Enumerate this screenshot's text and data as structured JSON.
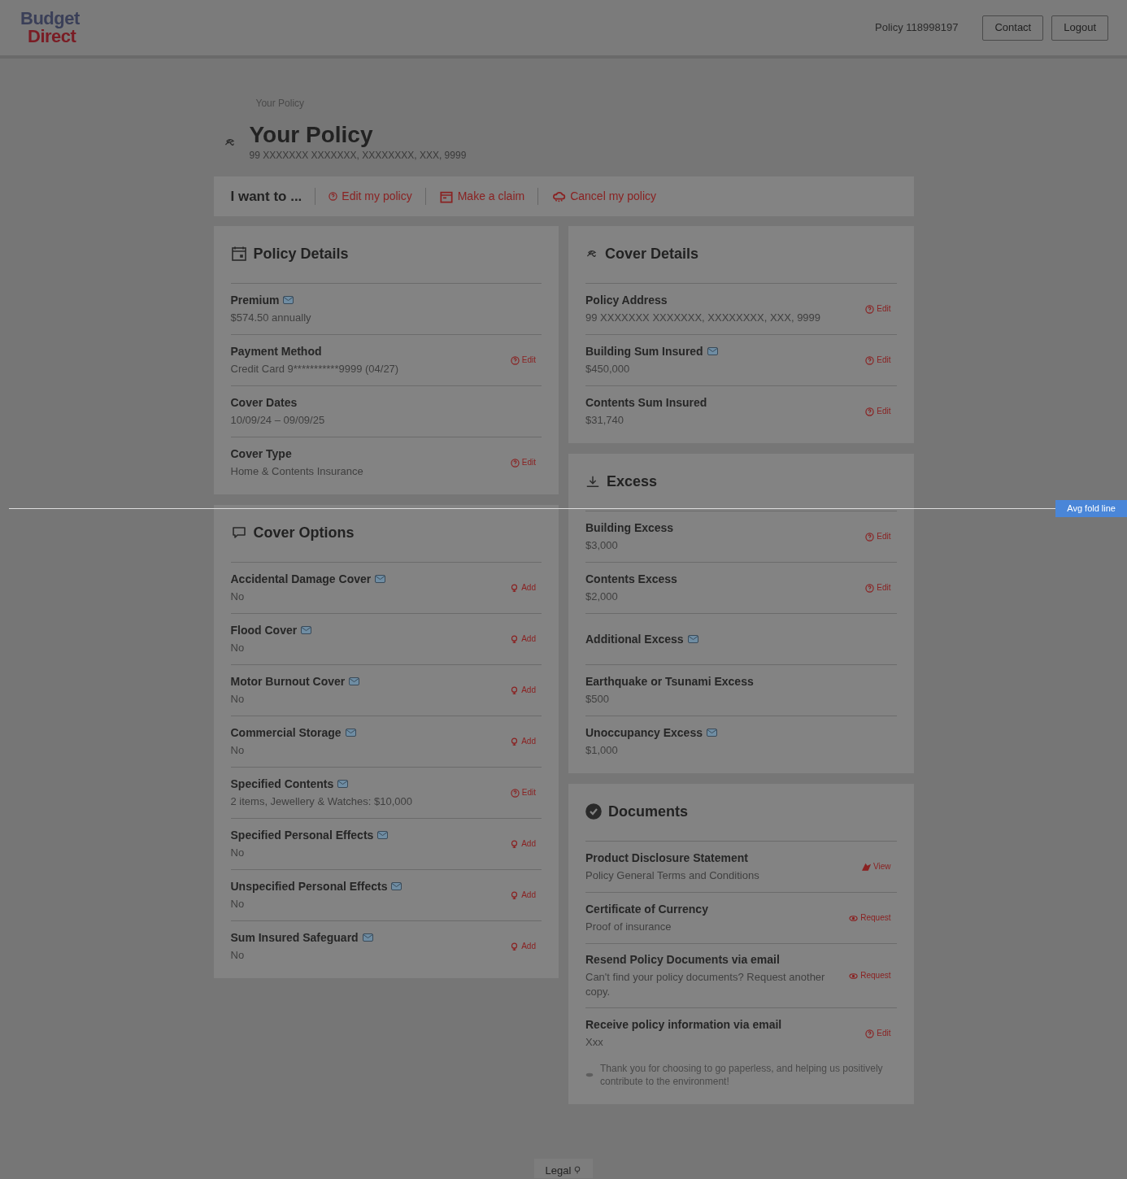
{
  "header": {
    "logo": [
      "Budget",
      "Direct"
    ],
    "policy_number": "Policy 118998197",
    "buttons": [
      "Contact",
      "Logout"
    ]
  },
  "breadcrumb": "Your Policy",
  "title": "Your Policy",
  "address": "99 XXXXXXX XXXXXXX, XXXXXXXX, XXX, 9999",
  "actions_bar": {
    "label": "I want to ...",
    "links": [
      {
        "kind": "edit",
        "label": "Edit my policy"
      },
      {
        "kind": "claim",
        "label": "Make a claim"
      },
      {
        "kind": "cancel",
        "label": "Cancel my policy"
      }
    ]
  },
  "columns": [
    [
      {
        "kind": "calendar",
        "title": "Policy Details",
        "rows": [
          {
            "label": "Premium",
            "value": "$574.50 annually",
            "info": true
          },
          {
            "label": "Payment Method",
            "value": "Credit Card 9***********9999 (04/27)",
            "info": false,
            "action": {
              "kind": "edit",
              "label": "Edit"
            }
          },
          {
            "label": "Cover Dates",
            "value": "10/09/24 – 09/09/25",
            "info": false
          },
          {
            "label": "Cover Type",
            "value": "Home & Contents Insurance",
            "info": false,
            "action": {
              "kind": "edit",
              "label": "Edit"
            }
          }
        ]
      },
      {
        "kind": "chat",
        "title": "Cover Options",
        "rows": [
          {
            "label": "Accidental Damage Cover",
            "value": "No",
            "info": true,
            "action": {
              "kind": "add",
              "label": "Add"
            }
          },
          {
            "label": "Flood Cover",
            "value": "No",
            "info": true,
            "action": {
              "kind": "add",
              "label": "Add"
            }
          },
          {
            "label": "Motor Burnout Cover",
            "value": "No",
            "info": true,
            "action": {
              "kind": "add",
              "label": "Add"
            }
          },
          {
            "label": "Commercial Storage",
            "value": "No",
            "info": true,
            "action": {
              "kind": "add",
              "label": "Add"
            }
          },
          {
            "label": "Specified Contents",
            "value": "2 items, Jewellery & Watches: $10,000",
            "info": true,
            "action": {
              "kind": "edit",
              "label": "Edit"
            }
          },
          {
            "label": "Specified Personal Effects",
            "value": "No",
            "info": true,
            "action": {
              "kind": "add",
              "label": "Add"
            }
          },
          {
            "label": "Unspecified Personal Effects",
            "value": "No",
            "info": true,
            "action": {
              "kind": "add",
              "label": "Add"
            }
          },
          {
            "label": "Sum Insured Safeguard",
            "value": "No",
            "info": true,
            "action": {
              "kind": "add",
              "label": "Add"
            }
          }
        ]
      }
    ],
    [
      {
        "kind": "umbrella",
        "title": "Cover Details",
        "rows": [
          {
            "label": "Policy Address",
            "value": "99 XXXXXXX XXXXXXX, XXXXXXXX, XXX, 9999",
            "info": false,
            "action": {
              "kind": "edit",
              "label": "Edit"
            }
          },
          {
            "label": "Building Sum Insured",
            "value": "$450,000",
            "info": true,
            "action": {
              "kind": "edit",
              "label": "Edit"
            }
          },
          {
            "label": "Contents Sum Insured",
            "value": "$31,740",
            "info": false,
            "action": {
              "kind": "edit",
              "label": "Edit"
            }
          }
        ]
      },
      {
        "kind": "download",
        "title": "Excess",
        "rows": [
          {
            "label": "Building Excess",
            "value": "$3,000",
            "info": false,
            "action": {
              "kind": "edit",
              "label": "Edit"
            }
          },
          {
            "label": "Contents Excess",
            "value": "$2,000",
            "info": false,
            "action": {
              "kind": "edit",
              "label": "Edit"
            }
          },
          {
            "label": "Additional Excess",
            "info": true
          },
          {
            "label": "Earthquake or Tsunami Excess",
            "value": "$500",
            "info": false
          },
          {
            "label": "Unoccupancy Excess",
            "value": "$1,000",
            "info": true
          }
        ]
      },
      {
        "kind": "check",
        "title": "Documents",
        "rows": [
          {
            "label": "Product Disclosure Statement",
            "value": "Policy General Terms and Conditions",
            "info": false,
            "action": {
              "kind": "view",
              "label": "View"
            }
          },
          {
            "label": "Certificate of Currency",
            "value": "Proof of insurance",
            "info": false,
            "action": {
              "kind": "request",
              "label": "Request"
            }
          },
          {
            "label": "Resend Policy Documents via email",
            "value": "Can't find your policy documents? Request another copy.",
            "info": false,
            "action": {
              "kind": "request",
              "label": "Request"
            }
          },
          {
            "label": "Receive policy information via email",
            "value": "Xxx",
            "info": false,
            "action": {
              "kind": "edit",
              "label": "Edit"
            }
          }
        ],
        "note": "Thank you for choosing to go paperless, and helping us positively contribute to the environment!"
      }
    ]
  ],
  "fold_line": "Avg fold line",
  "footer": "Legal"
}
